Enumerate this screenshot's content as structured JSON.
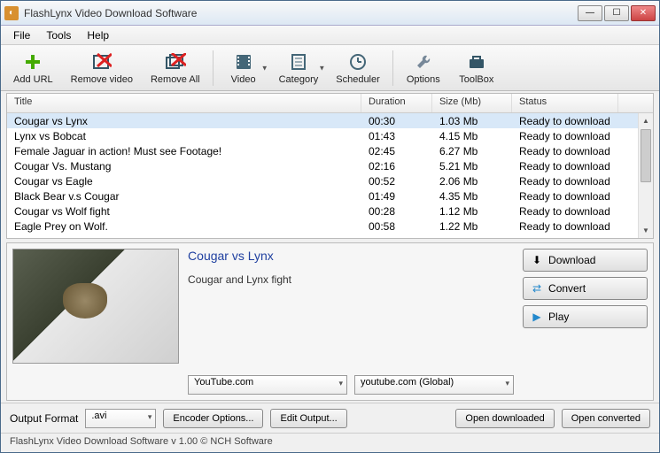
{
  "window": {
    "title": "FlashLynx Video Download Software"
  },
  "menu": {
    "file": "File",
    "tools": "Tools",
    "help": "Help"
  },
  "toolbar": {
    "add_url": "Add URL",
    "remove_video": "Remove video",
    "remove_all": "Remove All",
    "video": "Video",
    "category": "Category",
    "scheduler": "Scheduler",
    "options": "Options",
    "toolbox": "ToolBox"
  },
  "columns": {
    "title": "Title",
    "duration": "Duration",
    "size": "Size (Mb)",
    "status": "Status"
  },
  "rows": [
    {
      "title": "Cougar vs Lynx",
      "duration": "00:30",
      "size": "1.03 Mb",
      "status": "Ready to download",
      "selected": true
    },
    {
      "title": "Lynx vs Bobcat",
      "duration": "01:43",
      "size": "4.15 Mb",
      "status": "Ready to download"
    },
    {
      "title": "Female Jaguar in action! Must see Footage!",
      "duration": "02:45",
      "size": "6.27 Mb",
      "status": "Ready to download"
    },
    {
      "title": "Cougar Vs. Mustang",
      "duration": "02:16",
      "size": "5.21 Mb",
      "status": "Ready to download"
    },
    {
      "title": "Cougar vs Eagle",
      "duration": "00:52",
      "size": "2.06 Mb",
      "status": "Ready to download"
    },
    {
      "title": "Black Bear v.s Cougar",
      "duration": "01:49",
      "size": "4.35 Mb",
      "status": "Ready to download"
    },
    {
      "title": "Cougar vs Wolf fight",
      "duration": "00:28",
      "size": "1.12 Mb",
      "status": "Ready to download"
    },
    {
      "title": "Eagle Prey on Wolf.",
      "duration": "00:58",
      "size": "1.22 Mb",
      "status": "Ready to download"
    }
  ],
  "detail": {
    "title": "Cougar vs Lynx",
    "description": "Cougar and Lynx fight",
    "source_site": "YouTube.com",
    "source_region": "youtube.com (Global)"
  },
  "actions": {
    "download": "Download",
    "convert": "Convert",
    "play": "Play"
  },
  "bottom": {
    "output_format_label": "Output Format",
    "output_format": ".avi",
    "encoder_options": "Encoder Options...",
    "edit_output": "Edit Output...",
    "open_downloaded": "Open downloaded",
    "open_converted": "Open converted"
  },
  "status": "FlashLynx Video Download Software v 1.00 © NCH Software"
}
